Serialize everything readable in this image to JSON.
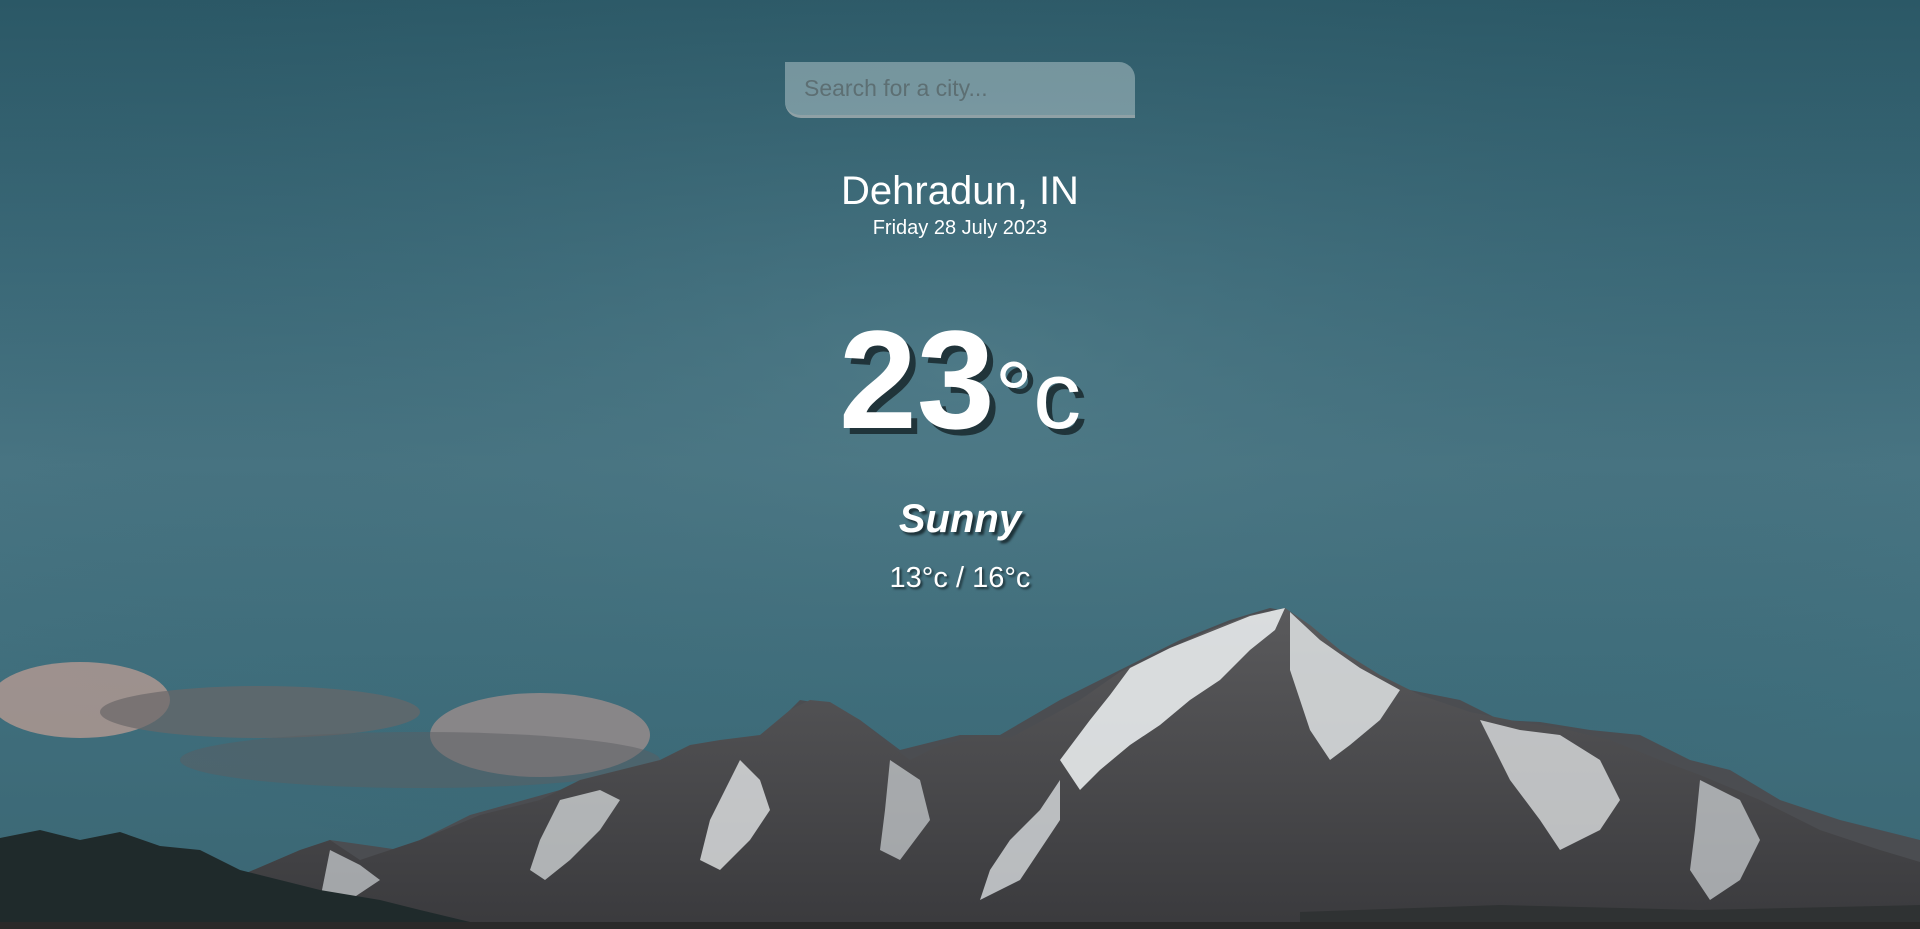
{
  "search": {
    "placeholder": "Search for a city...",
    "value": ""
  },
  "location": {
    "city": "Dehradun, IN",
    "date": "Friday 28 July 2023"
  },
  "current": {
    "temperature": "23",
    "unit": "°c"
  },
  "condition": "Sunny",
  "range": "13°c / 16°c",
  "colors": {
    "text": "#ffffff",
    "sky_top": "#2b5866",
    "sky_mid": "#4a7684"
  }
}
